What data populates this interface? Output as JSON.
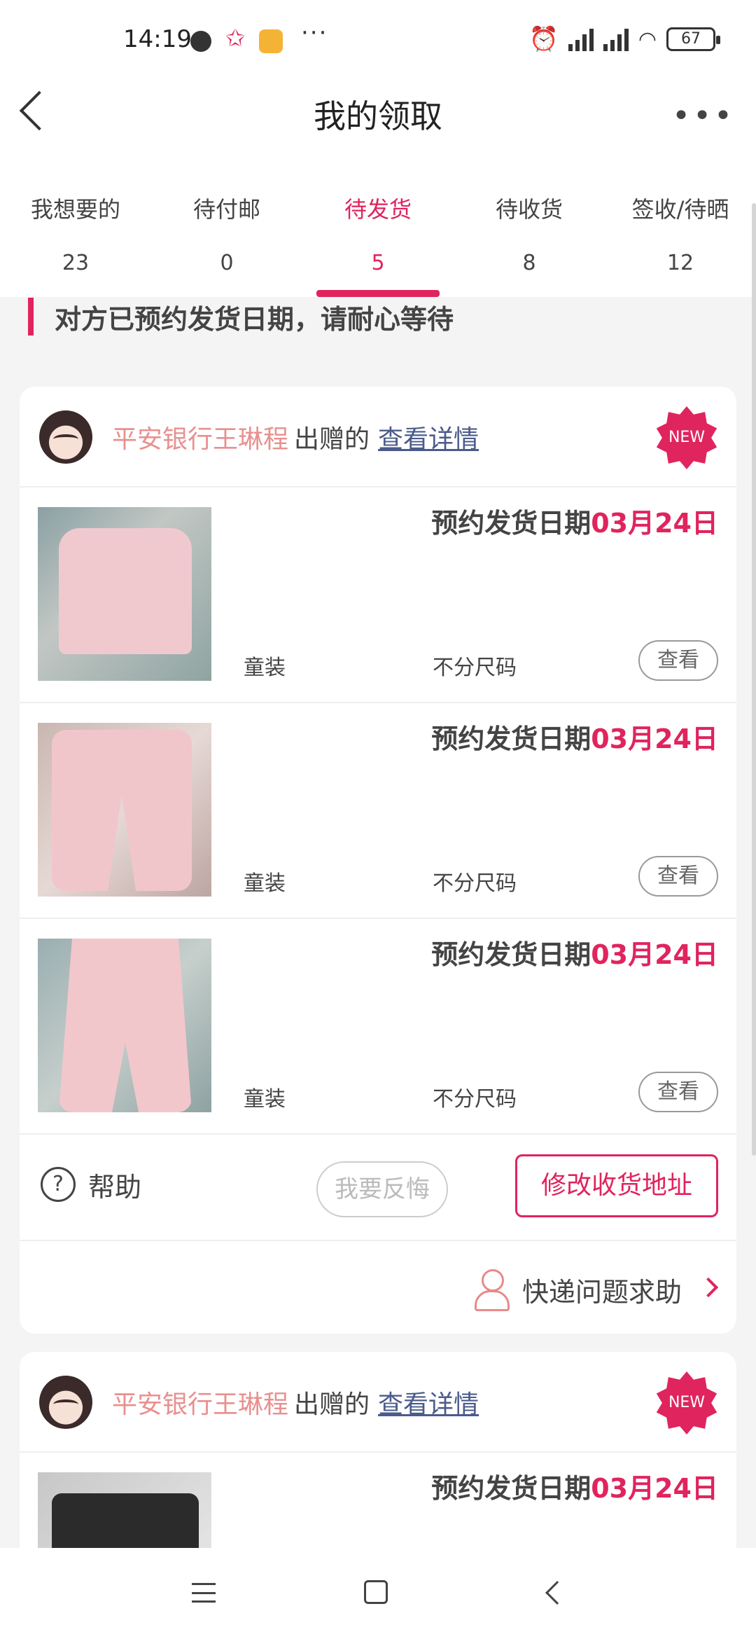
{
  "status_bar": {
    "time": "14:19",
    "battery": "67",
    "icons": [
      "dot-icon",
      "star-icon",
      "app-icon",
      "more-dots",
      "alarm-icon",
      "hd-signal-icon",
      "hd-signal-icon",
      "wifi-icon",
      "battery-icon"
    ]
  },
  "header": {
    "title": "我的领取",
    "back_icon": "chevron-left-icon",
    "more_icon": "more-horizontal-icon"
  },
  "tabs": [
    {
      "label": "我想要的",
      "count": "23",
      "active": false
    },
    {
      "label": "待付邮",
      "count": "0",
      "active": false
    },
    {
      "label": "待发货",
      "count": "5",
      "active": true
    },
    {
      "label": "待收货",
      "count": "8",
      "active": false
    },
    {
      "label": "签收/待晒",
      "count": "12",
      "active": false
    }
  ],
  "notice": "对方已预约发货日期，请耐心等待",
  "cards": [
    {
      "donor": "平安银行王琳程",
      "donor_suffix": "出赠的",
      "detail_link": "查看详情",
      "badge": "NEW",
      "items": [
        {
          "ship_label": "预约发货日期",
          "ship_date": "03月24日",
          "category": "童装",
          "size": "不分尺码",
          "view": "查看"
        },
        {
          "ship_label": "预约发货日期",
          "ship_date": "03月24日",
          "category": "童装",
          "size": "不分尺码",
          "view": "查看"
        },
        {
          "ship_label": "预约发货日期",
          "ship_date": "03月24日",
          "category": "童装",
          "size": "不分尺码",
          "view": "查看"
        }
      ],
      "help_icon": "?",
      "help": "帮助",
      "regret": "我要反悔",
      "change_address": "修改收货地址",
      "courier_help": "快递问题求助"
    },
    {
      "donor": "平安银行王琳程",
      "donor_suffix": "出赠的",
      "detail_link": "查看详情",
      "badge": "NEW",
      "items": [
        {
          "ship_label": "预约发货日期",
          "ship_date": "03月24日"
        }
      ]
    }
  ],
  "colors": {
    "accent": "#e0245e",
    "donor_name": "#e8908f",
    "link": "#4b5b8a"
  }
}
